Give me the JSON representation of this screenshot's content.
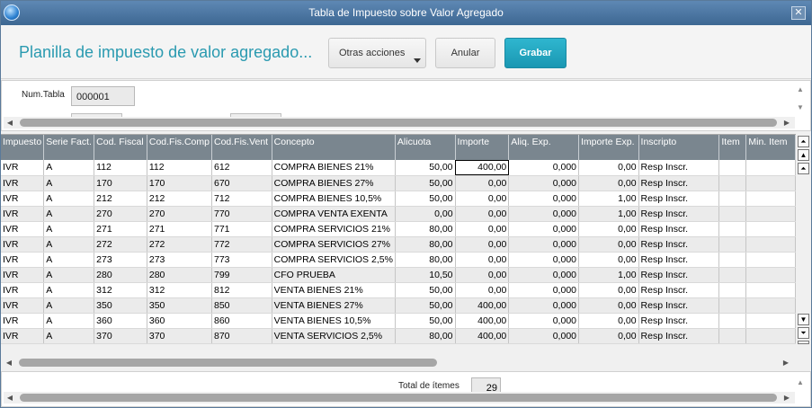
{
  "window": {
    "title": "Tabla de Impuesto sobre Valor Agregado"
  },
  "header": {
    "title": "Planilla de impuesto de valor agregado...",
    "otras_acciones_label": "Otras acciones",
    "anular_label": "Anular",
    "grabar_label": "Grabar"
  },
  "form": {
    "num_tabla_label": "Num.Tabla",
    "num_tabla_value": "000001"
  },
  "table": {
    "columns": [
      "Impuesto",
      "Serie Fact.",
      "Cod. Fiscal",
      "Cod.Fis.Comp",
      "Cod.Fis.Vent",
      "Concepto",
      "Alicuota",
      "Importe",
      "Aliq. Exp.",
      "Importe Exp.",
      "Inscripto",
      "Item",
      "Min. Item"
    ],
    "rows": [
      [
        "IVR",
        "A",
        "112",
        "112",
        "612",
        "COMPRA BIENES 21%",
        "50,00",
        "400,00",
        "0,000",
        "0,00",
        "Resp Inscr.",
        "",
        ""
      ],
      [
        "IVR",
        "A",
        "170",
        "170",
        "670",
        "COMPRA BIENES 27%",
        "50,00",
        "0,00",
        "0,000",
        "0,00",
        "Resp Inscr.",
        "",
        ""
      ],
      [
        "IVR",
        "A",
        "212",
        "212",
        "712",
        "COMPRA BIENES 10,5%",
        "50,00",
        "0,00",
        "0,000",
        "1,00",
        "Resp Inscr.",
        "",
        ""
      ],
      [
        "IVR",
        "A",
        "270",
        "270",
        "770",
        "COMPRA VENTA EXENTA",
        "0,00",
        "0,00",
        "0,000",
        "1,00",
        "Resp Inscr.",
        "",
        ""
      ],
      [
        "IVR",
        "A",
        "271",
        "271",
        "771",
        "COMPRA SERVICIOS 21%",
        "80,00",
        "0,00",
        "0,000",
        "0,00",
        "Resp Inscr.",
        "",
        ""
      ],
      [
        "IVR",
        "A",
        "272",
        "272",
        "772",
        "COMPRA SERVICIOS 27%",
        "80,00",
        "0,00",
        "0,000",
        "0,00",
        "Resp Inscr.",
        "",
        ""
      ],
      [
        "IVR",
        "A",
        "273",
        "273",
        "773",
        "COMPRA SERVICIOS 2,5%",
        "80,00",
        "0,00",
        "0,000",
        "0,00",
        "Resp Inscr.",
        "",
        ""
      ],
      [
        "IVR",
        "A",
        "280",
        "280",
        "799",
        "CFO PRUEBA",
        "10,50",
        "0,00",
        "0,000",
        "1,00",
        "Resp Inscr.",
        "",
        ""
      ],
      [
        "IVR",
        "A",
        "312",
        "312",
        "812",
        "VENTA BIENES 21%",
        "50,00",
        "0,00",
        "0,000",
        "0,00",
        "Resp Inscr.",
        "",
        ""
      ],
      [
        "IVR",
        "A",
        "350",
        "350",
        "850",
        "VENTA BIENES 27%",
        "50,00",
        "400,00",
        "0,000",
        "0,00",
        "Resp Inscr.",
        "",
        ""
      ],
      [
        "IVR",
        "A",
        "360",
        "360",
        "860",
        "VENTA BIENES 10,5%",
        "50,00",
        "400,00",
        "0,000",
        "0,00",
        "Resp Inscr.",
        "",
        ""
      ],
      [
        "IVR",
        "A",
        "370",
        "370",
        "870",
        "VENTA SERVICIOS 2,5%",
        "80,00",
        "400,00",
        "0,000",
        "0,00",
        "Resp Inscr.",
        "",
        ""
      ]
    ]
  },
  "footer": {
    "total_label": "Total de ítemes",
    "total_value": "29"
  },
  "icons": {
    "app": "app-logo-icon",
    "close": "close-icon",
    "dropdown": "chevron-down-icon"
  }
}
